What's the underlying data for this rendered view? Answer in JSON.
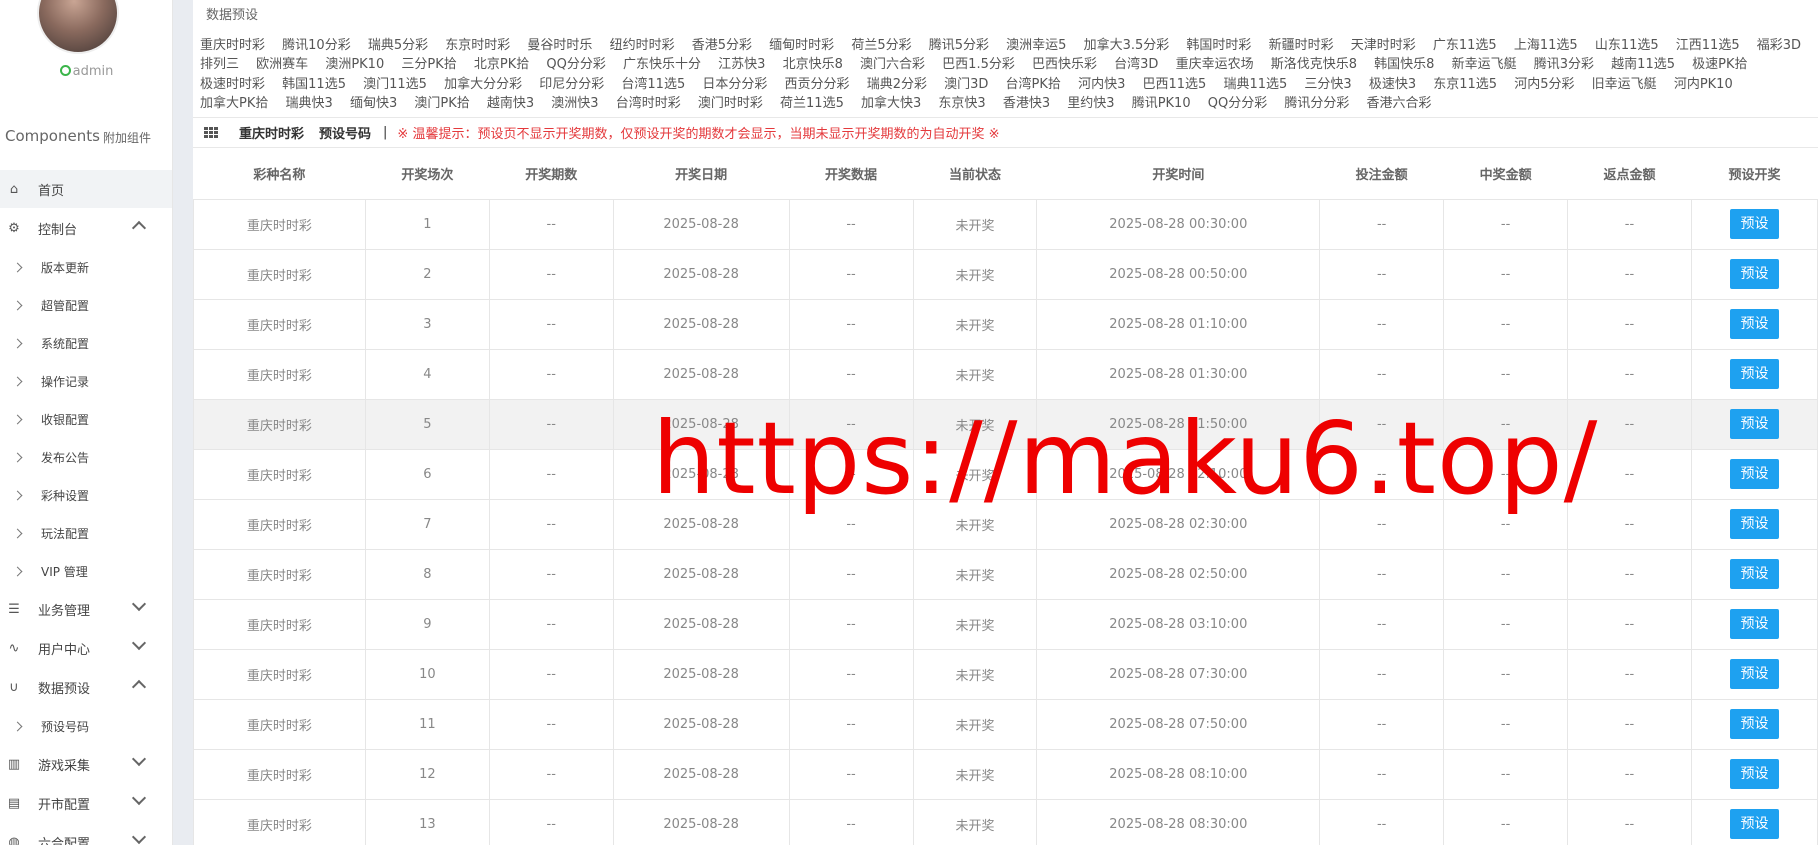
{
  "user": {
    "name": "admin"
  },
  "sidebar": {
    "components_label": "Components",
    "components_sub": "附加组件",
    "items": [
      {
        "label": "首页",
        "icon": "home-icon"
      },
      {
        "label": "控制台",
        "icon": "gear-icon"
      },
      {
        "label": "业务管理",
        "icon": "menu-icon"
      },
      {
        "label": "用户中心",
        "icon": "pulse-icon"
      },
      {
        "label": "数据预设",
        "icon": "magnet-icon"
      },
      {
        "label": "游戏采集",
        "icon": "columns-icon"
      },
      {
        "label": "开市配置",
        "icon": "clipboard-icon"
      },
      {
        "label": "六合配置",
        "icon": "globe-icon"
      }
    ],
    "console_sub": [
      "版本更新",
      "超管配置",
      "系统配置",
      "操作记录",
      "收银配置",
      "发布公告",
      "彩种设置",
      "玩法配置",
      "VIP 管理"
    ],
    "preset_sub": [
      "预设号码"
    ]
  },
  "breadcrumb": "数据预设",
  "lotteries": [
    "重庆时时彩",
    "腾讯10分彩",
    "瑞典5分彩",
    "东京时时彩",
    "曼谷时时乐",
    "纽约时时彩",
    "香港5分彩",
    "缅甸时时彩",
    "荷兰5分彩",
    "腾讯5分彩",
    "澳洲幸运5",
    "加拿大3.5分彩",
    "韩国时时彩",
    "新疆时时彩",
    "天津时时彩",
    "广东11选5",
    "上海11选5",
    "山东11选5",
    "江西11选5",
    "福彩3D",
    "排列三",
    "欧洲赛车",
    "澳洲PK10",
    "三分PK拾",
    "北京PK拾",
    "QQ分分彩",
    "广东快乐十分",
    "江苏快3",
    "北京快乐8",
    "澳门六合彩",
    "巴西1.5分彩",
    "巴西快乐彩",
    "台湾3D",
    "重庆幸运农场",
    "斯洛伐克快乐8",
    "韩国快乐8",
    "新幸运飞艇",
    "腾讯3分彩",
    "越南11选5",
    "极速PK拾",
    "极速时时彩",
    "韩国11选5",
    "澳门11选5",
    "加拿大分分彩",
    "印尼分分彩",
    "台湾11选5",
    "日本分分彩",
    "西贡分分彩",
    "瑞典2分彩",
    "澳门3D",
    "台湾PK拾",
    "河内快3",
    "巴西11选5",
    "瑞典11选5",
    "三分快3",
    "极速快3",
    "东京11选5",
    "河内5分彩",
    "旧幸运飞艇",
    "河内PK10",
    "加拿大PK拾",
    "瑞典快3",
    "缅甸快3",
    "澳门PK拾",
    "越南快3",
    "澳洲快3",
    "台湾时时彩",
    "澳门时时彩",
    "荷兰11选5",
    "加拿大快3",
    "东京快3",
    "香港快3",
    "里约快3",
    "腾讯PK10",
    "QQ分分彩",
    "腾讯分分彩",
    "香港六合彩"
  ],
  "toolbar": {
    "tab_lottery": "重庆时时彩",
    "tab_preset": "预设号码",
    "separator": "|",
    "warning": "※ 温馨提示：预设页不显示开奖期数，仅预设开奖的期数才会显示，当期未显示开奖期数的为自动开奖 ※"
  },
  "table": {
    "headers": [
      "彩种名称",
      "开奖场次",
      "开奖期数",
      "开奖日期",
      "开奖数据",
      "当前状态",
      "开奖时间",
      "投注金额",
      "中奖金额",
      "返点金额",
      "预设开奖"
    ],
    "button_label": "预设",
    "rows": [
      [
        "重庆时时彩",
        "1",
        "--",
        "2025-08-28",
        "--",
        "未开奖",
        "2025-08-28 00:30:00",
        "--",
        "--",
        "--"
      ],
      [
        "重庆时时彩",
        "2",
        "--",
        "2025-08-28",
        "--",
        "未开奖",
        "2025-08-28 00:50:00",
        "--",
        "--",
        "--"
      ],
      [
        "重庆时时彩",
        "3",
        "--",
        "2025-08-28",
        "--",
        "未开奖",
        "2025-08-28 01:10:00",
        "--",
        "--",
        "--"
      ],
      [
        "重庆时时彩",
        "4",
        "--",
        "2025-08-28",
        "--",
        "未开奖",
        "2025-08-28 01:30:00",
        "--",
        "--",
        "--"
      ],
      [
        "重庆时时彩",
        "5",
        "--",
        "2025-08-28",
        "--",
        "未开奖",
        "2025-08-28 01:50:00",
        "--",
        "--",
        "--"
      ],
      [
        "重庆时时彩",
        "6",
        "--",
        "2025-08-28",
        "--",
        "未开奖",
        "2025-08-28 02:10:00",
        "--",
        "--",
        "--"
      ],
      [
        "重庆时时彩",
        "7",
        "--",
        "2025-08-28",
        "--",
        "未开奖",
        "2025-08-28 02:30:00",
        "--",
        "--",
        "--"
      ],
      [
        "重庆时时彩",
        "8",
        "--",
        "2025-08-28",
        "--",
        "未开奖",
        "2025-08-28 02:50:00",
        "--",
        "--",
        "--"
      ],
      [
        "重庆时时彩",
        "9",
        "--",
        "2025-08-28",
        "--",
        "未开奖",
        "2025-08-28 03:10:00",
        "--",
        "--",
        "--"
      ],
      [
        "重庆时时彩",
        "10",
        "--",
        "2025-08-28",
        "--",
        "未开奖",
        "2025-08-28 07:30:00",
        "--",
        "--",
        "--"
      ],
      [
        "重庆时时彩",
        "11",
        "--",
        "2025-08-28",
        "--",
        "未开奖",
        "2025-08-28 07:50:00",
        "--",
        "--",
        "--"
      ],
      [
        "重庆时时彩",
        "12",
        "--",
        "2025-08-28",
        "--",
        "未开奖",
        "2025-08-28 08:10:00",
        "--",
        "--",
        "--"
      ],
      [
        "重庆时时彩",
        "13",
        "--",
        "2025-08-28",
        "--",
        "未开奖",
        "2025-08-28 08:30:00",
        "--",
        "--",
        "--"
      ]
    ]
  },
  "watermark": "https://maku6.top/",
  "colors": {
    "accent": "#1ea1f0",
    "warning": "#e4393c",
    "watermark": "#ee0000",
    "online": "#3bb54a"
  }
}
